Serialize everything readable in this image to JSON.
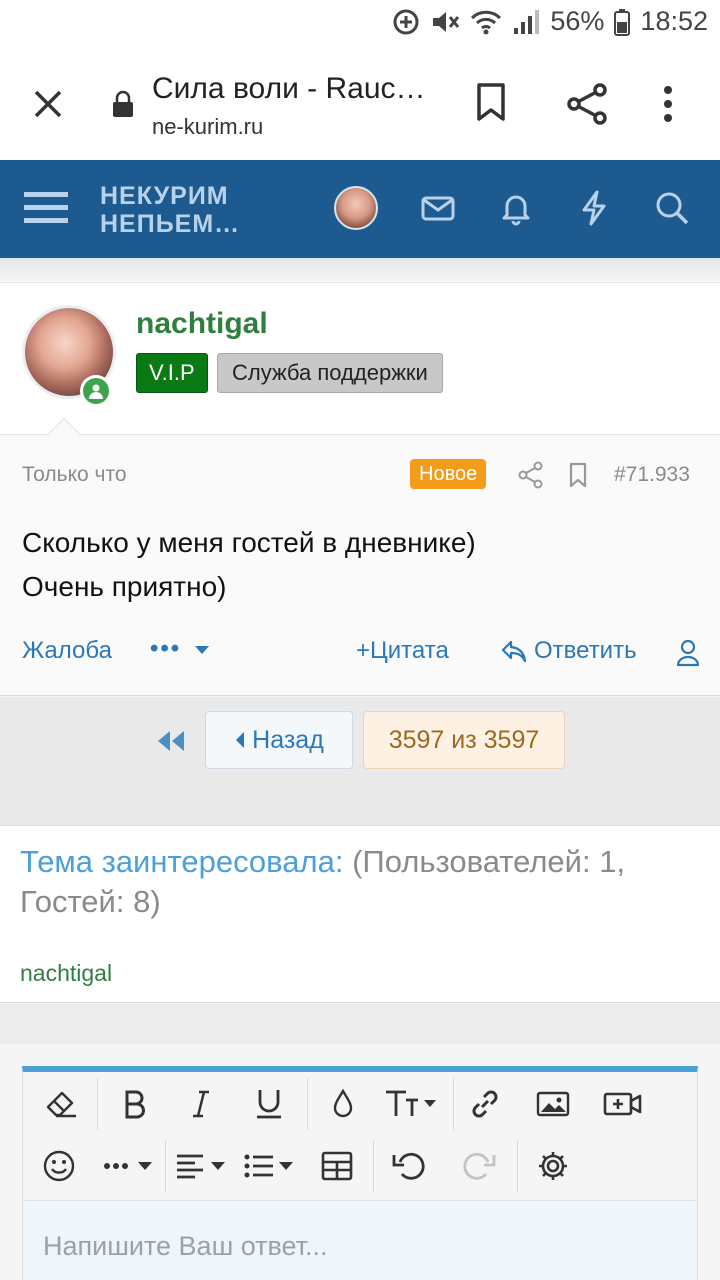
{
  "status_bar": {
    "battery": "56%",
    "time": "18:52"
  },
  "browser": {
    "title": "Сила воли - Rauc…",
    "url": "ne-kurim.ru"
  },
  "site": {
    "logo_line1": "НЕКУРИМ",
    "logo_line2": "НЕПЬЕМ…",
    "header_color": "#1d5a8f"
  },
  "post": {
    "username": "nachtigal",
    "badges": [
      "V.I.P",
      "Служба поддержки"
    ],
    "time": "Только что",
    "new_label": "Новое",
    "number": "#71.933",
    "body_lines": [
      "Сколько у меня гостей в дневнике)",
      "Очень приятно)"
    ],
    "actions": {
      "complaint": "Жалоба",
      "more": "•••",
      "quote": "Цитата",
      "reply": "Ответить"
    }
  },
  "pager": {
    "back": "Назад",
    "page_info": "3597 из 3597"
  },
  "interested": {
    "label": "Тема заинтересовала:",
    "stats": "(Пользователей: 1, Гостей: 8)",
    "users": [
      "nachtigal"
    ]
  },
  "editor": {
    "placeholder": "Напишите Ваш ответ..."
  },
  "colors": {
    "accent": "#4aa0d8",
    "link": "#2b78b9",
    "username": "#2f7f3f",
    "new_badge": "#f29c1a",
    "vip": "#0a7a14"
  }
}
